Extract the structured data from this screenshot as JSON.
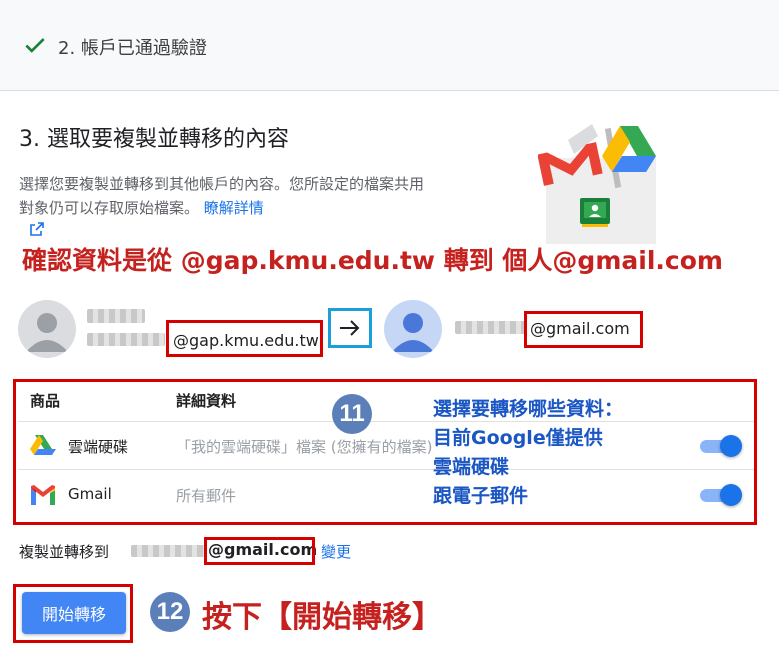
{
  "step2": {
    "label": "2. 帳戶已通過驗證",
    "icon": "check-icon"
  },
  "section": {
    "title": "3. 選取要複製並轉移的內容",
    "description": "選擇您要複製並轉移到其他帳戶的內容。您所設定的檔案共用對象仍可以存取原始檔案。",
    "learn_more": "瞭解詳情"
  },
  "annotations": {
    "confirm": "確認資料是從 @gap.kmu.edu.tw 轉到 個人@gmail.com",
    "step11": "11",
    "select_line1": "選擇要轉移哪些資料：",
    "select_line2": "目前Google僅提供",
    "select_line3": "雲端硬碟",
    "select_line4": "跟電子郵件",
    "step12": "12",
    "press": "按下【開始轉移】"
  },
  "accounts": {
    "source_domain": "@gap.kmu.edu.tw",
    "target_domain": "@gmail.com"
  },
  "table": {
    "headers": [
      "商品",
      "詳細資料"
    ],
    "rows": [
      {
        "product": "雲端硬碟",
        "detail": "「我的雲端硬碟」檔案 (您擁有的檔案)",
        "icon": "google-drive-icon",
        "enabled": true
      },
      {
        "product": "Gmail",
        "detail": "所有郵件",
        "icon": "gmail-icon",
        "enabled": true
      }
    ]
  },
  "transfer": {
    "label": "複製並轉移到",
    "domain": "@gmail.com",
    "change": "變更"
  },
  "start_button": "開始轉移",
  "colors": {
    "accent": "#1a73e8",
    "annotation_red": "#c5221f",
    "annotation_blue": "#1a56c4",
    "highlight_border": "#d50000"
  }
}
